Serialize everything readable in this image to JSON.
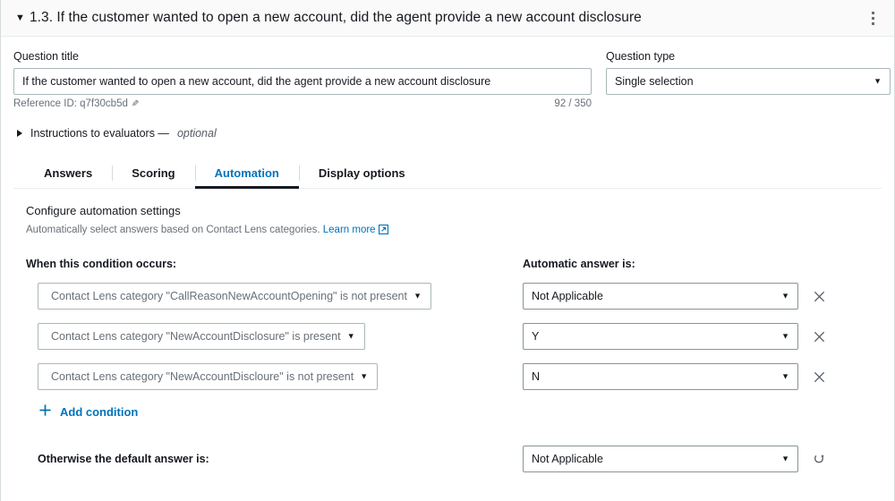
{
  "header": {
    "caret_icon": "caret-down-icon",
    "title": "1.3. If the customer wanted to open a new account, did the agent provide a new account disclosure",
    "menu_icon": "kebab-menu-icon"
  },
  "question": {
    "title_label": "Question title",
    "title_value": "If the customer wanted to open a new account, did the agent provide a new account disclosure",
    "reference_id": "Reference ID: q7f30cb5d",
    "edit_icon": "pencil-icon",
    "char_counter": "92 / 350",
    "type_label": "Question type",
    "type_value": "Single selection",
    "type_arrow_icon": "chevron-down-icon"
  },
  "instructions": {
    "expand_icon": "caret-right-icon",
    "label": "Instructions to evaluators — ",
    "optional": "optional"
  },
  "tabs": [
    {
      "label": "Answers",
      "active": false
    },
    {
      "label": "Scoring",
      "active": false
    },
    {
      "label": "Automation",
      "active": true
    },
    {
      "label": "Display options",
      "active": false
    }
  ],
  "automation": {
    "section_title": "Configure automation settings",
    "section_desc": "Automatically select answers based on Contact Lens categories. ",
    "learn_more": "Learn more",
    "learn_more_icon": "external-link-icon",
    "condition_column_label": "When this condition occurs:",
    "answer_column_label": "Automatic answer is:",
    "rows": [
      {
        "condition": "Contact Lens category \"CallReasonNewAccountOpening\" is not present",
        "answer": "Not Applicable",
        "remove_icon": "close-icon"
      },
      {
        "condition": "Contact Lens category \"NewAccountDisclosure\" is present",
        "answer": "Y",
        "remove_icon": "close-icon"
      },
      {
        "condition": "Contact Lens category \"NewAccountDiscloure\" is not present",
        "answer": "N",
        "remove_icon": "close-icon"
      }
    ],
    "add_condition_icon": "plus-icon",
    "add_condition_label": "Add condition",
    "default_label": "Otherwise the default answer is:",
    "default_answer": "Not Applicable",
    "reset_icon": "reset-icon"
  },
  "colors": {
    "accent_link": "#0073bb",
    "text_primary": "#16191f",
    "text_secondary": "#687078",
    "border": "#aab7b8",
    "header_bg": "#fafafa"
  }
}
